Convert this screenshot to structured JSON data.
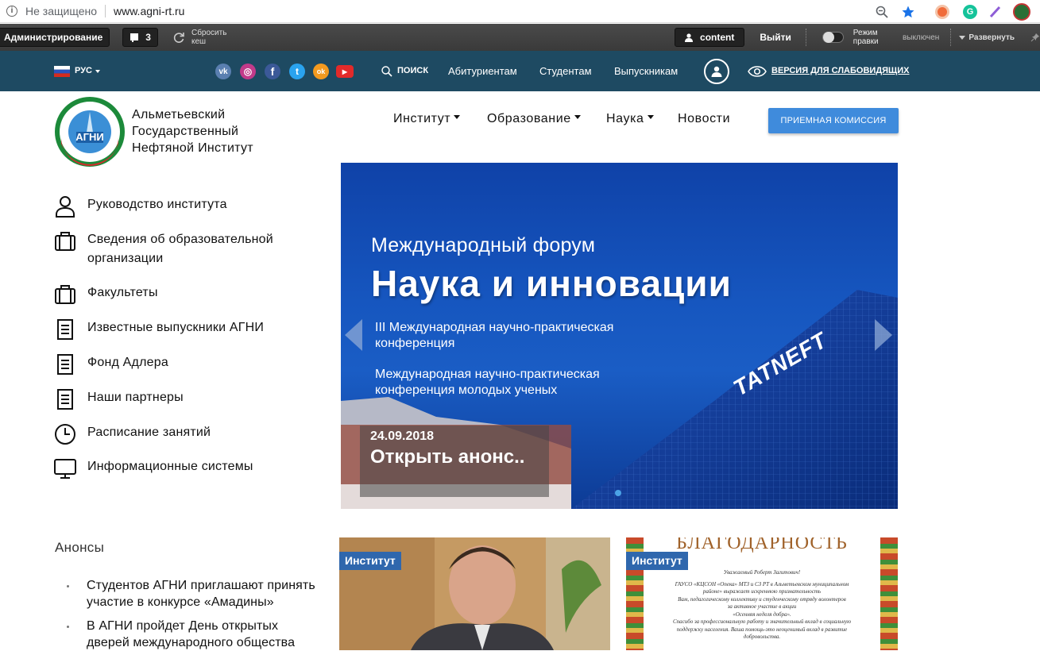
{
  "browser": {
    "info_glyph": "i",
    "security": "Не защищено",
    "url": "www.agni-rt.ru",
    "icons": [
      "zoom-icon",
      "bookmark-star-icon",
      "extension-icon",
      "grammarly-icon",
      "pen-extension-icon",
      "profile-avatar-icon"
    ]
  },
  "admin": {
    "administration": "Администрирование",
    "badge_count": "3",
    "clear_cache": "Сбросить кеш",
    "content": "content",
    "logout": "Выйти",
    "edit_mode_label": "Режим правки",
    "edit_mode_state": "выключен",
    "expand": "Развернуть"
  },
  "topbar": {
    "language": "РУС",
    "social": [
      {
        "name": "vk-icon",
        "glyph": "vk",
        "color": "#5a7fb0"
      },
      {
        "name": "instagram-icon",
        "glyph": "◎",
        "color": "#c23a8a"
      },
      {
        "name": "facebook-icon",
        "glyph": "f",
        "color": "#3b5998"
      },
      {
        "name": "twitter-icon",
        "glyph": "t",
        "color": "#2aa3ef"
      },
      {
        "name": "odnoklassniki-icon",
        "glyph": "ok",
        "color": "#f39a1f"
      },
      {
        "name": "youtube-icon",
        "glyph": "▶",
        "color": "#e22a2a"
      }
    ],
    "search": "ПОИСК",
    "applicants": "Абитуриентам",
    "students": "Студентам",
    "graduates": "Выпускникам",
    "accessibility": "ВЕРСИЯ ДЛЯ СЛАБОВИДЯЩИХ"
  },
  "header": {
    "logo_text": "АГНИ",
    "name_line1": "Альметьевский",
    "name_line2": "Государственный",
    "name_line3": "Нефтяной Институт",
    "menu": [
      "Институт",
      "Образование",
      "Наука",
      "Новости"
    ],
    "admission": "ПРИЕМНАЯ КОМИССИЯ"
  },
  "sidebar": {
    "items": [
      {
        "label": "Руководство института",
        "icon": "person-icon"
      },
      {
        "label_1": "Сведения об образовательной",
        "label_2": "организации",
        "icon": "briefcase-icon"
      },
      {
        "label": "Факультеты",
        "icon": "briefcase-icon"
      },
      {
        "label": "Известные выпускники АГНИ",
        "icon": "document-icon"
      },
      {
        "label": "Фонд Адлера",
        "icon": "document-icon"
      },
      {
        "label": "Наши партнеры",
        "icon": "document-icon"
      },
      {
        "label": "Расписание занятий",
        "icon": "clock-icon"
      },
      {
        "label": "Информационные системы",
        "icon": "monitor-icon"
      }
    ]
  },
  "slider": {
    "subtitle": "Международный форум",
    "title": "Наука и инновации",
    "line1": "III Международная научно-практическая",
    "line2": "конференция",
    "line3": "Международная научно-практическая",
    "line4": "конференция молодых ученых",
    "brand": "TATNEFT",
    "date": "24.09.2018",
    "open": "Открыть анонс.."
  },
  "announcements": {
    "heading": "Анонсы",
    "items": [
      {
        "l1": "Студентов АГНИ приглашают принять",
        "l2": "участие в конкурсе «Амадины»"
      },
      {
        "l1": "В АГНИ пройдет День открытых",
        "l2": "дверей международного общества"
      }
    ]
  },
  "cards": {
    "tag1": "Институт",
    "tag2": "Институт",
    "thanks_title": "БЛАГОДАРНОСТЬ",
    "thanks_greeting": "Уважаемый Роберт Загитович!",
    "thanks_l1": "ГАУСО «КЦСОН «Опека» МТЗ и СЗ РТ в Альметьевском муниципальном",
    "thanks_l2": "районе» выражает искреннюю признательность",
    "thanks_l3": "Вам, педагогическому коллективу и студенческому отряду волонтеров",
    "thanks_l4": "за активное участие в акции",
    "thanks_l5": "«Осенняя неделя добра».",
    "thanks_l6": "Спасибо за профессиональную работу и значительный вклад в социальную",
    "thanks_l7": "поддержку населения. Ваша помощь-это неоценимый вклад в развитие",
    "thanks_l8": "добровольства."
  }
}
